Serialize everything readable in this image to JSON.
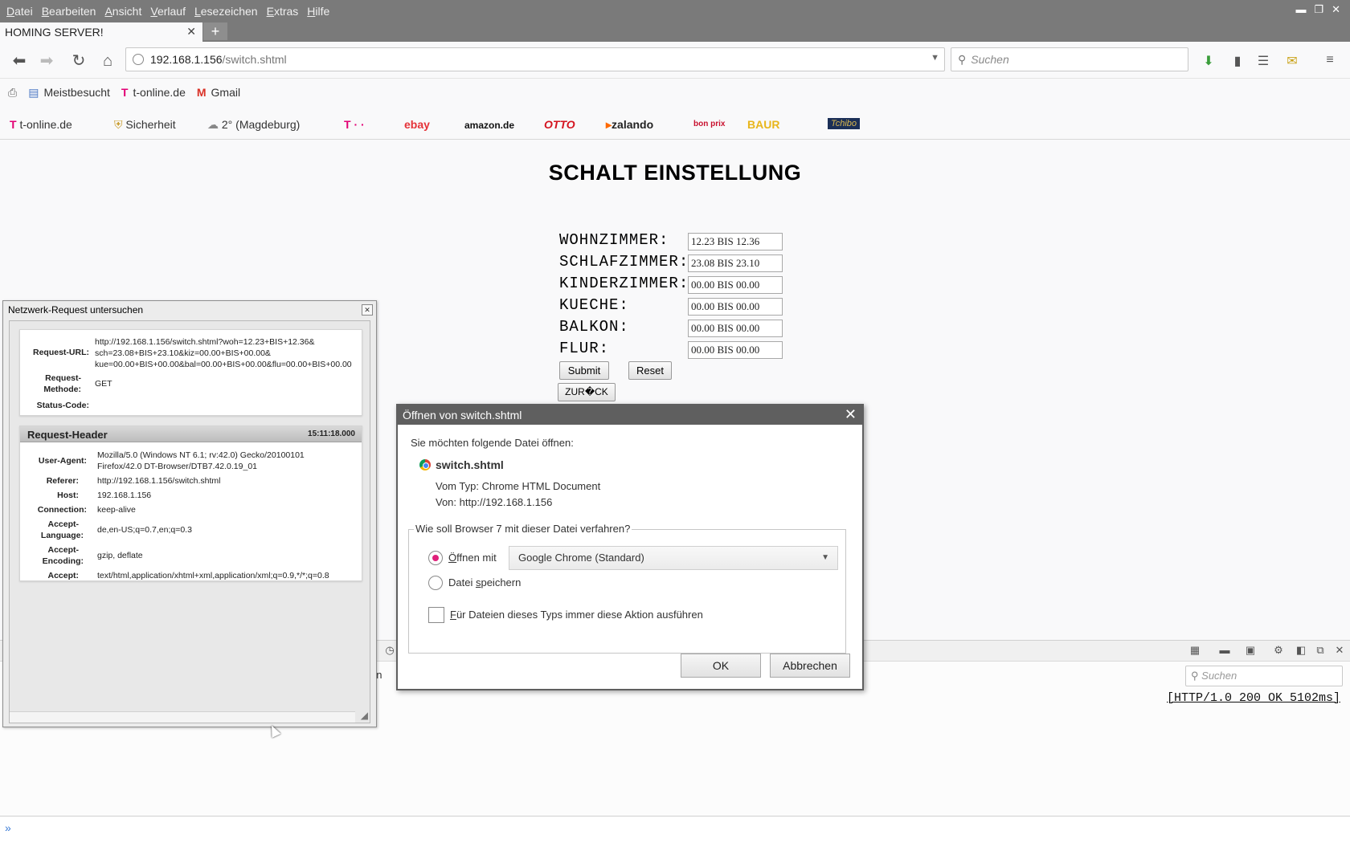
{
  "menubar": {
    "items": [
      {
        "pre": "",
        "ul": "D",
        "post": "atei"
      },
      {
        "pre": "",
        "ul": "B",
        "post": "earbeiten"
      },
      {
        "pre": "",
        "ul": "A",
        "post": "nsicht"
      },
      {
        "pre": "",
        "ul": "V",
        "post": "erlauf"
      },
      {
        "pre": "",
        "ul": "L",
        "post": "esezeichen"
      },
      {
        "pre": "",
        "ul": "E",
        "post": "xtras"
      },
      {
        "pre": "",
        "ul": "H",
        "post": "ilfe"
      }
    ]
  },
  "tab": {
    "title": "HOMING SERVER!"
  },
  "url": {
    "host": "192.168.1.156",
    "path": "/switch.shtml"
  },
  "search": {
    "placeholder": "Suchen"
  },
  "bookmarks": [
    {
      "label": "Meistbesucht"
    },
    {
      "label": "t-online.de"
    },
    {
      "label": "Gmail"
    }
  ],
  "brands": {
    "tonline": "t-online.de",
    "sicherheit": "Sicherheit",
    "weather": "2° (Magdeburg)",
    "telekom": "T · ·",
    "ebay": "ebay",
    "amazon": "amazon.de",
    "otto": "OTTO",
    "zalando": "zalando",
    "bonprix": "bon prix",
    "baur": "BAUR",
    "tchibo": "Tchibo"
  },
  "page": {
    "title": "SCHALT EINSTELLUNG",
    "rows": [
      {
        "label": "WOHNZIMMER:",
        "value": "12.23 BIS 12.36"
      },
      {
        "label": "SCHLAFZIMMER:",
        "value": "23.08 BIS 23.10"
      },
      {
        "label": "KINDERZIMMER:",
        "value": "00.00 BIS 00.00"
      },
      {
        "label": "KUECHE:",
        "value": "00.00 BIS 00.00"
      },
      {
        "label": "BALKON:",
        "value": "00.00 BIS 00.00"
      },
      {
        "label": "FLUR:",
        "value": "00.00 BIS 00.00"
      }
    ],
    "submit": "Submit",
    "reset": "Reset",
    "back": "ZUR�CK"
  },
  "network": {
    "window_title": "Netzwerk-Request untersuchen",
    "request_url_label": "Request-URL:",
    "request_url_lines": [
      "http://192.168.1.156/switch.shtml?woh=12.23+BIS+12.36&",
      "sch=23.08+BIS+23.10&kiz=00.00+BIS+00.00&",
      "kue=00.00+BIS+00.00&bal=00.00+BIS+00.00&flu=00.00+BIS+00.00"
    ],
    "method_label_1": "Request-",
    "method_label_2": "Methode:",
    "method": "GET",
    "status_label": "Status-Code:",
    "header_title": "Request-Header",
    "header_time": "15:11:18.000",
    "headers": {
      "ua_label": "User-Agent:",
      "ua_1": "Mozilla/5.0 (Windows NT 6.1; rv:42.0) Gecko/20100101",
      "ua_2": "Firefox/42.0 DT-Browser/DTB7.42.0.19_01",
      "ref_label": "Referer:",
      "ref": "http://192.168.1.156/switch.shtml",
      "host_label": "Host:",
      "host": "192.168.1.156",
      "conn_label": "Connection:",
      "conn": "keep-alive",
      "lang_label_1": "Accept-",
      "lang_label_2": "Language:",
      "lang": "de,en-US;q=0.7,en;q=0.3",
      "enc_label_1": "Accept-",
      "enc_label_2": "Encoding:",
      "enc": "gzip, deflate",
      "accept_label": "Accept:",
      "accept": "text/html,application/xhtml+xml,application/xml;q=0.9,*/*;q=0.8"
    }
  },
  "dialog": {
    "title": "Öffnen von switch.shtml",
    "intro": "Sie möchten folgende Datei öffnen:",
    "filename": "switch.shtml",
    "type_label": "Vom Typ:",
    "type": "Chrome HTML Document",
    "from_label": "Von:",
    "from": "http://192.168.1.156",
    "question": "Wie soll Browser 7 mit dieser Datei verfahren?",
    "open_with_ul": "Ö",
    "open_with_rest": "ffnen mit",
    "app": "Google Chrome (Standard)",
    "save_pre": "Datei ",
    "save_ul": "s",
    "save_post": "peichern",
    "always_ul": "F",
    "always_rest": "ür Dateien dieses Typs immer diese Aktion ausführen",
    "ok": "OK",
    "cancel": "Abbrechen"
  },
  "devtools": {
    "search_placeholder": "Suchen",
    "partial_tab": "en",
    "status": "[HTTP/1.0 200 OK 5102ms]"
  }
}
